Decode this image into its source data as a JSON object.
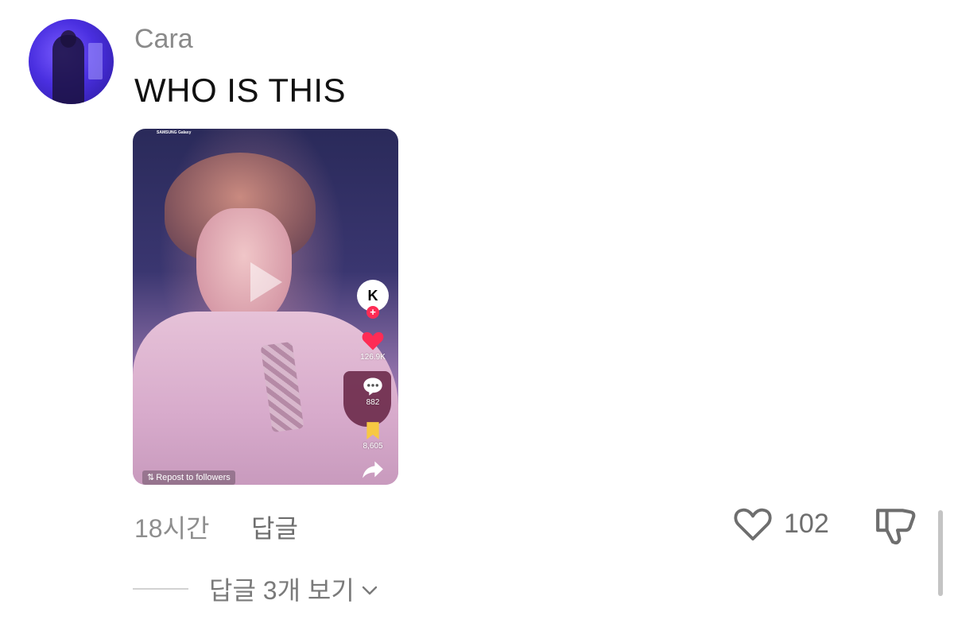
{
  "comment": {
    "username": "Cara",
    "text": "WHO IS THIS",
    "time_ago": "18시간",
    "reply_label": "답글",
    "like_count": "102",
    "view_replies_label": "답글 3개 보기"
  },
  "video": {
    "brand_text": "SAMSUNG Galaxy",
    "account_initial": "K",
    "likes": "126.9K",
    "comments": "882",
    "saves": "8,605",
    "repost_label": "Repost to followers"
  },
  "icons": {
    "like": "heart-outline-icon",
    "dislike": "thumbs-down-icon",
    "chevron": "chevron-down-icon",
    "video_like": "heart-icon",
    "video_comment": "comment-icon",
    "video_save": "bookmark-icon",
    "video_share": "share-icon",
    "play": "play-icon"
  },
  "colors": {
    "like_red": "#fe2c55",
    "bookmark_yellow": "#f7c843",
    "muted_text": "#8e8e8e"
  }
}
